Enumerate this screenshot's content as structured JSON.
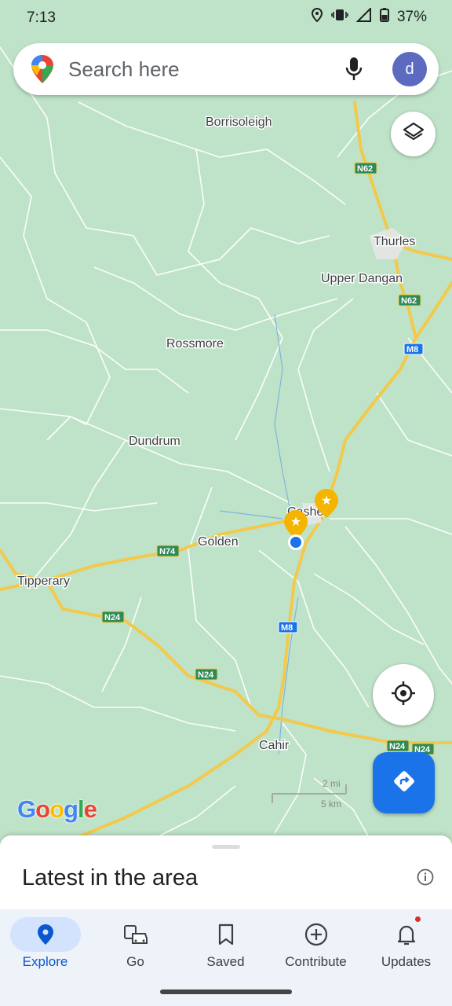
{
  "status_bar": {
    "time": "7:13",
    "battery": "37%"
  },
  "search": {
    "placeholder": "Search here",
    "avatar_letter": "d"
  },
  "map": {
    "places": [
      {
        "id": "borrisoleigh",
        "label": "Borrisoleigh"
      },
      {
        "id": "thurles",
        "label": "Thurles"
      },
      {
        "id": "upper-dangan",
        "label": "Upper Dangan"
      },
      {
        "id": "rossmore",
        "label": "Rossmore"
      },
      {
        "id": "dundrum",
        "label": "Dundrum"
      },
      {
        "id": "cashel",
        "label": "Cashel"
      },
      {
        "id": "golden",
        "label": "Golden"
      },
      {
        "id": "tipperary",
        "label": "Tipperary"
      },
      {
        "id": "cahir",
        "label": "Cahir"
      }
    ],
    "road_shields": [
      {
        "id": "n62-a",
        "label": "N62",
        "color": "#2e8b57"
      },
      {
        "id": "n62-b",
        "label": "N62",
        "color": "#2e8b57"
      },
      {
        "id": "m8-a",
        "label": "M8",
        "color": "#1a73e8"
      },
      {
        "id": "m8-b",
        "label": "M8",
        "color": "#1a73e8"
      },
      {
        "id": "n74",
        "label": "N74",
        "color": "#2e8b57"
      },
      {
        "id": "n24-a",
        "label": "N24",
        "color": "#2e8b57"
      },
      {
        "id": "n24-b",
        "label": "N24",
        "color": "#2e8b57"
      },
      {
        "id": "n24-c",
        "label": "N24",
        "color": "#2e8b57"
      },
      {
        "id": "n24-d",
        "label": "N24",
        "color": "#2e8b57"
      }
    ],
    "scale": {
      "miles": "2 mi",
      "km": "5 km"
    },
    "attribution": "Google"
  },
  "sheet": {
    "title": "Latest in the area"
  },
  "nav": [
    {
      "id": "explore",
      "label": "Explore",
      "icon": "pin-icon"
    },
    {
      "id": "go",
      "label": "Go",
      "icon": "commute-icon"
    },
    {
      "id": "saved",
      "label": "Saved",
      "icon": "bookmark-icon"
    },
    {
      "id": "contribute",
      "label": "Contribute",
      "icon": "add-circle-icon"
    },
    {
      "id": "updates",
      "label": "Updates",
      "icon": "bell-icon"
    }
  ],
  "colors": {
    "accent": "#1a73e8",
    "road": "#f2c94c",
    "land": "#bfe3c8",
    "nav_active": "#d3e3fd"
  }
}
